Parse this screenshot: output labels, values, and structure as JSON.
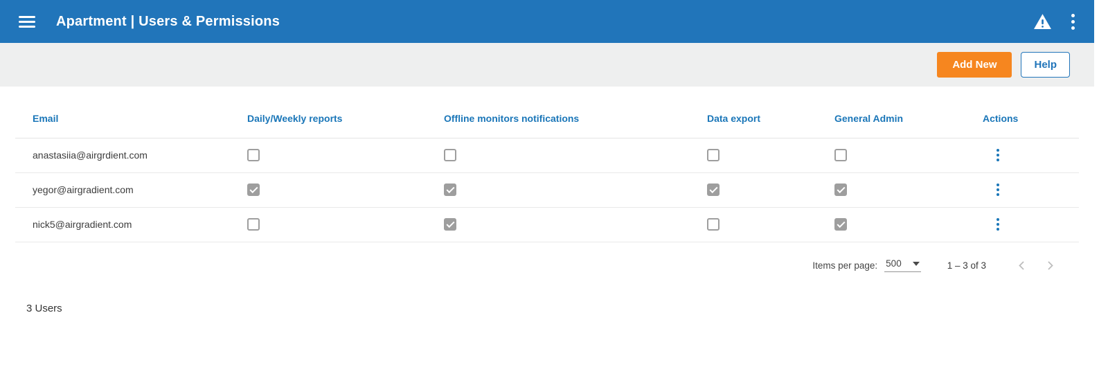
{
  "header": {
    "title": "Apartment | Users & Permissions"
  },
  "toolbar": {
    "add_new_label": "Add New",
    "help_label": "Help"
  },
  "table": {
    "columns": [
      "Email",
      "Daily/Weekly reports",
      "Offline monitors notifications",
      "Data export",
      "General Admin",
      "Actions"
    ],
    "rows": [
      {
        "email": "anastasiia@airgrdient.com",
        "daily_weekly": false,
        "offline_monitors": false,
        "data_export": false,
        "general_admin": false
      },
      {
        "email": "yegor@airgradient.com",
        "daily_weekly": true,
        "offline_monitors": true,
        "data_export": true,
        "general_admin": true
      },
      {
        "email": "nick5@airgradient.com",
        "daily_weekly": false,
        "offline_monitors": true,
        "data_export": false,
        "general_admin": true
      }
    ]
  },
  "pagination": {
    "items_per_page_label": "Items per page:",
    "items_per_page_value": "500",
    "range_label": "1 – 3 of 3"
  },
  "footer": {
    "user_count_label": "3 Users"
  },
  "colors": {
    "header_bg": "#2175BA",
    "accent_orange": "#F6861F",
    "link_blue": "#1A76B8",
    "checkbox_gray": "#9E9E9E"
  }
}
